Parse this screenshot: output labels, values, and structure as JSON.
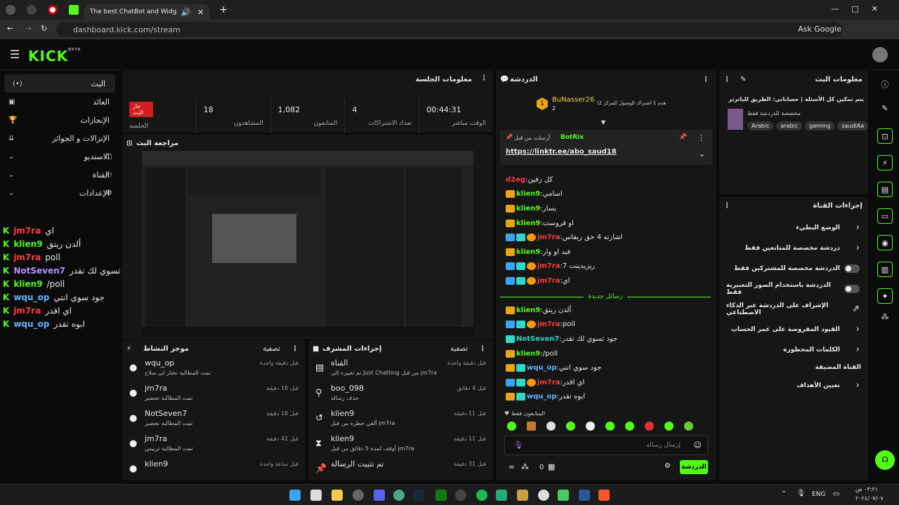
{
  "browser": {
    "tab_title": "The best ChatBot and Widg",
    "url": "dashboard.kick.com/stream",
    "ask_google": "Ask Google"
  },
  "brand": {
    "logo": "KICK",
    "beta": "BETA"
  },
  "sidebar": {
    "items": [
      {
        "label": "البث"
      },
      {
        "label": "العائد"
      },
      {
        "label": "الإنجازات"
      },
      {
        "label": "الإنزالات و الجوائز"
      },
      {
        "label": "الاستديو"
      },
      {
        "label": "القناة"
      },
      {
        "label": "الإعدادات"
      }
    ]
  },
  "sidechat": [
    {
      "user": "jm7ra",
      "msg": "اي",
      "color": "#ff3d3d"
    },
    {
      "user": "klien9",
      "msg": "ألدن ريتق",
      "color": "#53fc18"
    },
    {
      "user": "jm7ra",
      "msg": "poll",
      "color": "#ff3d3d"
    },
    {
      "user": "NotSeven7",
      "msg": "جود تسوي لك تقدر",
      "color": "#b78eff"
    },
    {
      "user": "klien9",
      "msg": "/poll",
      "color": "#53fc18"
    },
    {
      "user": "wqu_op",
      "msg": "جود سوي انتي",
      "color": "#62b5ff"
    },
    {
      "user": "jm7ra",
      "msg": "اي اقدر",
      "color": "#ff3d3d"
    },
    {
      "user": "wqu_op",
      "msg": "ابوه تقدر",
      "color": "#62b5ff"
    }
  ],
  "session": {
    "title": "معلومات الجلسة",
    "live_badge": "جار البث",
    "session_label": "الجلسة",
    "viewers": "18",
    "viewers_label": "المشاهدون",
    "followers": "1,082",
    "followers_label": "المتابعون",
    "subs": "4",
    "subs_label": "تعداد الاشتراكات",
    "time": "00:44:31",
    "time_label": "الوقت مباشر"
  },
  "preview": {
    "title": "مراجعة البث"
  },
  "activity": {
    "title": "موجز النشاط",
    "filter": "تصفية",
    "items": [
      {
        "name": "wqu_op",
        "sub": "تمت المطالبة تختار لي سلاح",
        "time": "قبل دقيقة واحدة"
      },
      {
        "name": "jm7ra",
        "sub": "تمت المطالبة تحضير",
        "time": "قبل 18 دقيقة"
      },
      {
        "name": "NotSeven7",
        "sub": "تمت المطالبة تحضير",
        "time": "قبل 18 دقيقة"
      },
      {
        "name": "jm7ra",
        "sub": "تمت المطالبة ترييس",
        "time": "قبل 42 دقيقة"
      },
      {
        "name": "klien9",
        "sub": "",
        "time": "قبل ساعة واحدة"
      }
    ]
  },
  "modactions": {
    "title": "إجراءات المشرف",
    "filter": "تصفية",
    "items": [
      {
        "name": "القناة",
        "sub": "تم تغييره إلى Just Chatting من قبل jm7ra",
        "time": "قبل دقيقة واحدة"
      },
      {
        "name": "boo_098",
        "sub": "حذف رسالة",
        "time": "قبل 4 دقائق"
      },
      {
        "name": "klien9",
        "sub": "ألغي حظره من قبل jm7ra",
        "time": "قبل 11 دقيقة"
      },
      {
        "name": "klien9",
        "sub": "أوقف لمدة 5 دقائق من قبل jm7ra",
        "time": "قبل 11 دقيقة"
      },
      {
        "name": "تم تثبيت الرسالة",
        "sub": "",
        "time": "قبل 31 دقيقة"
      }
    ]
  },
  "chat": {
    "title": "الدردشة",
    "top_user": "BuNasser26",
    "top_count": "2",
    "top_note": "(هدم 1 اشتراك للوصول للمركز 2",
    "pinned_by": "أرسلت من قبل",
    "pinned_user": "BotRix",
    "pinned_link": "https://linktr.ee/abo_saud18",
    "lines": [
      {
        "user": "d2eg",
        "msg": "كل زفين",
        "color": "#ff3d3d",
        "badges": []
      },
      {
        "user": "klien9",
        "msg": "اسامي",
        "color": "#53fc18",
        "badges": [
          "gold"
        ]
      },
      {
        "user": "klien9",
        "msg": "بسار",
        "color": "#53fc18",
        "badges": [
          "gold"
        ]
      },
      {
        "user": "klien9",
        "msg": "او فروست",
        "color": "#53fc18",
        "badges": [
          "gold"
        ]
      },
      {
        "user": "jm7ra",
        "msg": "اشارته 4 حق ريفاس",
        "color": "#ff3d3d",
        "badges": [
          "blue",
          "cyan",
          "orange"
        ]
      },
      {
        "user": "klien9",
        "msg": "فيد او وار",
        "color": "#53fc18",
        "badges": [
          "gold"
        ]
      },
      {
        "user": "jm7ra",
        "msg": "ريزيدينت 7",
        "color": "#ff3d3d",
        "badges": [
          "blue",
          "cyan",
          "orange"
        ]
      },
      {
        "user": "jm7ra",
        "msg": "اي",
        "color": "#ff3d3d",
        "badges": [
          "blue",
          "cyan",
          "orange"
        ]
      }
    ],
    "new_messages": "رسائل جديدة",
    "lines2": [
      {
        "user": "klien9",
        "msg": "ألدن ريتق",
        "color": "#53fc18",
        "badges": [
          "gold"
        ]
      },
      {
        "user": "jm7ra",
        "msg": "poll",
        "color": "#ff3d3d",
        "badges": [
          "blue",
          "cyan",
          "orange"
        ]
      },
      {
        "user": "NotSeven7",
        "msg": "جود تسوي لك تقدر",
        "color": "#2fd8c8",
        "badges": [
          "cyan"
        ]
      },
      {
        "user": "klien9",
        "msg": "/poll",
        "color": "#53fc18",
        "badges": [
          "gold"
        ]
      },
      {
        "user": "wqu_op",
        "msg": "جود سوي انتي",
        "color": "#62b5ff",
        "badges": [
          "gold",
          "cyan"
        ]
      },
      {
        "user": "jm7ra",
        "msg": "اي اقدر",
        "color": "#ff3d3d",
        "badges": [
          "blue",
          "cyan",
          "orange"
        ]
      },
      {
        "user": "wqu_op",
        "msg": "ابوه تقدر",
        "color": "#62b5ff",
        "badges": [
          "gold",
          "cyan"
        ]
      }
    ],
    "followers_only": "المتابعون فقط",
    "input_placeholder": "إرسال رسالة",
    "count": "0",
    "send": "الدردشة"
  },
  "streaminfo": {
    "title": "معلومات البث",
    "stream_title": "يتم تمكين كل الأسئلة | حساباتي: الطريق للباترنر",
    "category": "مخصصة للدردشة فقط",
    "tags": [
      "Arabic",
      "arabic",
      "gaming",
      "saudiAa"
    ]
  },
  "channelactions": {
    "title": "إجراءات القناة",
    "rows": [
      {
        "label": "الوضع البطيء",
        "type": "chevron"
      },
      {
        "label": "دردشة مخصصة للمتابعين فقط",
        "type": "chevron"
      },
      {
        "label": "الدردشة مخصصة للمشتركين فقط",
        "type": "toggle"
      },
      {
        "label": "الدردشة باستخدام الصور التعبيرية فقط",
        "type": "toggle"
      },
      {
        "label": "الإشراف على الدردشة عبر الذكاء الاصطناعي",
        "type": "link"
      },
      {
        "label": "القيود المفروضة على عمر الحساب",
        "type": "chevron"
      },
      {
        "label": "الكلمات المحظورة",
        "type": "chevron"
      },
      {
        "label": "القناة المضيفة",
        "type": "none"
      },
      {
        "label": "تعيين الأهداف",
        "type": "chevron"
      }
    ]
  },
  "taskbar": {
    "lang": "ENG",
    "time": "٠٣:٢١ ص",
    "date": "٢٠٢٤/٠٧/٠٧"
  }
}
